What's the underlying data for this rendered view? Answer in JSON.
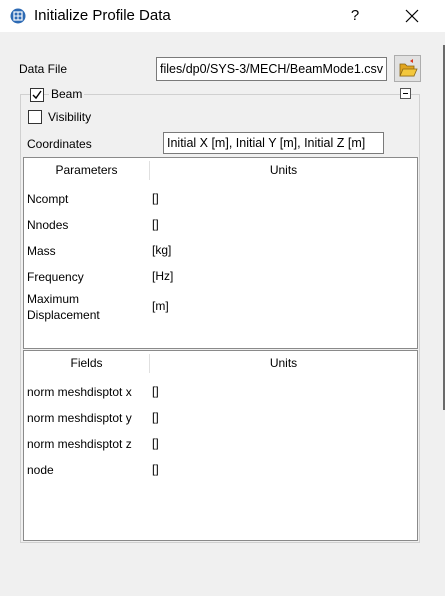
{
  "window": {
    "title": "Initialize Profile Data",
    "help_label": "?",
    "close_icon": "close-icon",
    "app_icon": "profile-data-icon"
  },
  "data_file": {
    "label": "Data File",
    "value": "files/dp0/SYS-3/MECH/BeamMode1.csv",
    "browse_icon": "open-folder-icon"
  },
  "beam": {
    "label": "Beam",
    "checked": true,
    "collapse_icon": "collapse-minus-icon",
    "visibility": {
      "label": "Visibility",
      "checked": false
    },
    "coordinates": {
      "label": "Coordinates",
      "value": "Initial X [m], Initial Y [m], Initial Z [m]"
    }
  },
  "parameters_table": {
    "headers": [
      "Parameters",
      "Units"
    ],
    "rows": [
      {
        "name": "Ncompt",
        "unit": "[]"
      },
      {
        "name": "Nnodes",
        "unit": "[]"
      },
      {
        "name": "Mass",
        "unit": "[kg]"
      },
      {
        "name": "Frequency",
        "unit": "[Hz]"
      },
      {
        "name_line1": "Maximum",
        "name_line2": "Displacement",
        "unit": "[m]"
      }
    ]
  },
  "fields_table": {
    "headers": [
      "Fields",
      "Units"
    ],
    "rows": [
      {
        "name": "norm meshdisptot x",
        "unit": "[]"
      },
      {
        "name": "norm meshdisptot y",
        "unit": "[]"
      },
      {
        "name": "norm meshdisptot z",
        "unit": "[]"
      },
      {
        "name": "node",
        "unit": "[]"
      }
    ]
  },
  "colors": {
    "title_bar": "#ffffff",
    "dialog_background": "#f0f0f0",
    "icon_blue": "#2d6ab4",
    "folder_yellow": "#f3c73c"
  }
}
